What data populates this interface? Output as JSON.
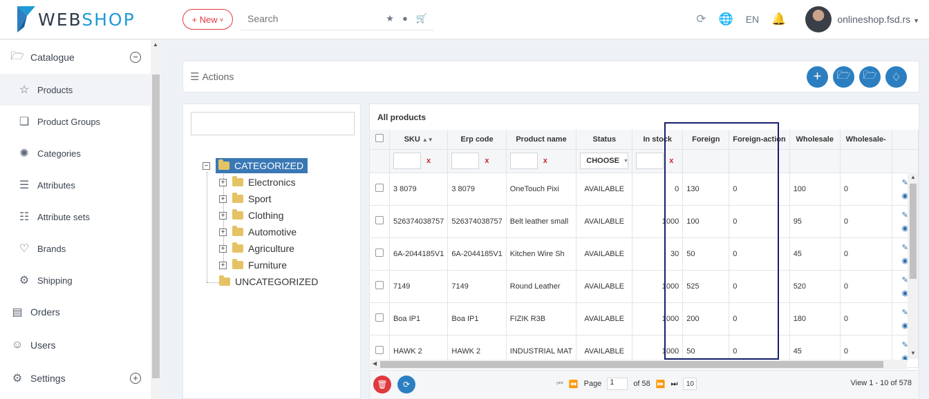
{
  "brand": {
    "logo_part1": "WEB",
    "logo_part2": "SHOP",
    "accent": "#1f9ad6"
  },
  "header": {
    "new_label": "+ New",
    "search_placeholder": "Search",
    "lang": "EN",
    "user_name": "onlineshop.fsd.rs"
  },
  "sidebar": {
    "items": [
      {
        "label": "Catalogue",
        "icon": "folder-open-icon"
      },
      {
        "label": "Products",
        "icon": "star-icon"
      },
      {
        "label": "Product Groups",
        "icon": "stack-icon"
      },
      {
        "label": "Categories",
        "icon": "network-icon"
      },
      {
        "label": "Attributes",
        "icon": "layers-icon"
      },
      {
        "label": "Attribute sets",
        "icon": "list-icon"
      },
      {
        "label": "Brands",
        "icon": "heart-icon"
      },
      {
        "label": "Shipping",
        "icon": "delivery-icon"
      },
      {
        "label": "Orders",
        "icon": "list-circle-icon"
      },
      {
        "label": "Users",
        "icon": "users-icon"
      },
      {
        "label": "Settings",
        "icon": "gear-icon"
      }
    ]
  },
  "actions": {
    "label": "Actions"
  },
  "tree": {
    "root": "CATEGORIZED",
    "children": [
      "Electronics",
      "Sport",
      "Clothing",
      "Automotive",
      "Agriculture",
      "Furniture"
    ],
    "other": "UNCATEGORIZED"
  },
  "grid": {
    "title": "All products",
    "columns": [
      "SKU",
      "Erp code",
      "Product name",
      "Status",
      "In stock",
      "Foreign",
      "Foreign-action",
      "Wholesale",
      "Wholesale-"
    ],
    "filter_clear": "x",
    "status_filter": "CHOOSE",
    "rows": [
      {
        "sku": "3 8079",
        "erp": "3 8079",
        "name": "OneTouch Pixi",
        "status": "AVAILABLE",
        "stock": "0",
        "foreign": "130",
        "foreign_action": "0",
        "wholesale": "100",
        "wholesale_action": "0"
      },
      {
        "sku": "526374038757",
        "erp": "526374038757",
        "name": "Belt leather small",
        "status": "AVAILABLE",
        "stock": "1000",
        "foreign": "100",
        "foreign_action": "0",
        "wholesale": "95",
        "wholesale_action": "0"
      },
      {
        "sku": "6A-2044185V1",
        "erp": "6A-2044185V1",
        "name": "Kitchen Wire Sh",
        "status": "AVAILABLE",
        "stock": "30",
        "foreign": "50",
        "foreign_action": "0",
        "wholesale": "45",
        "wholesale_action": "0"
      },
      {
        "sku": "7149",
        "erp": "7149",
        "name": "Round Leather",
        "status": "AVAILABLE",
        "stock": "1000",
        "foreign": "525",
        "foreign_action": "0",
        "wholesale": "520",
        "wholesale_action": "0"
      },
      {
        "sku": "Boa IP1",
        "erp": "Boa IP1",
        "name": "FIZIK R3B",
        "status": "AVAILABLE",
        "stock": "1000",
        "foreign": "200",
        "foreign_action": "0",
        "wholesale": "180",
        "wholesale_action": "0"
      },
      {
        "sku": "HAWK 2",
        "erp": "HAWK 2",
        "name": "INDUSTRIAL MAT",
        "status": "AVAILABLE",
        "stock": "1000",
        "foreign": "50",
        "foreign_action": "0",
        "wholesale": "45",
        "wholesale_action": "0"
      }
    ]
  },
  "pager": {
    "page_label": "Page",
    "page_value": "1",
    "of_label": "of 58",
    "page_size": "10",
    "view_info": "View 1 - 10 of 578"
  }
}
